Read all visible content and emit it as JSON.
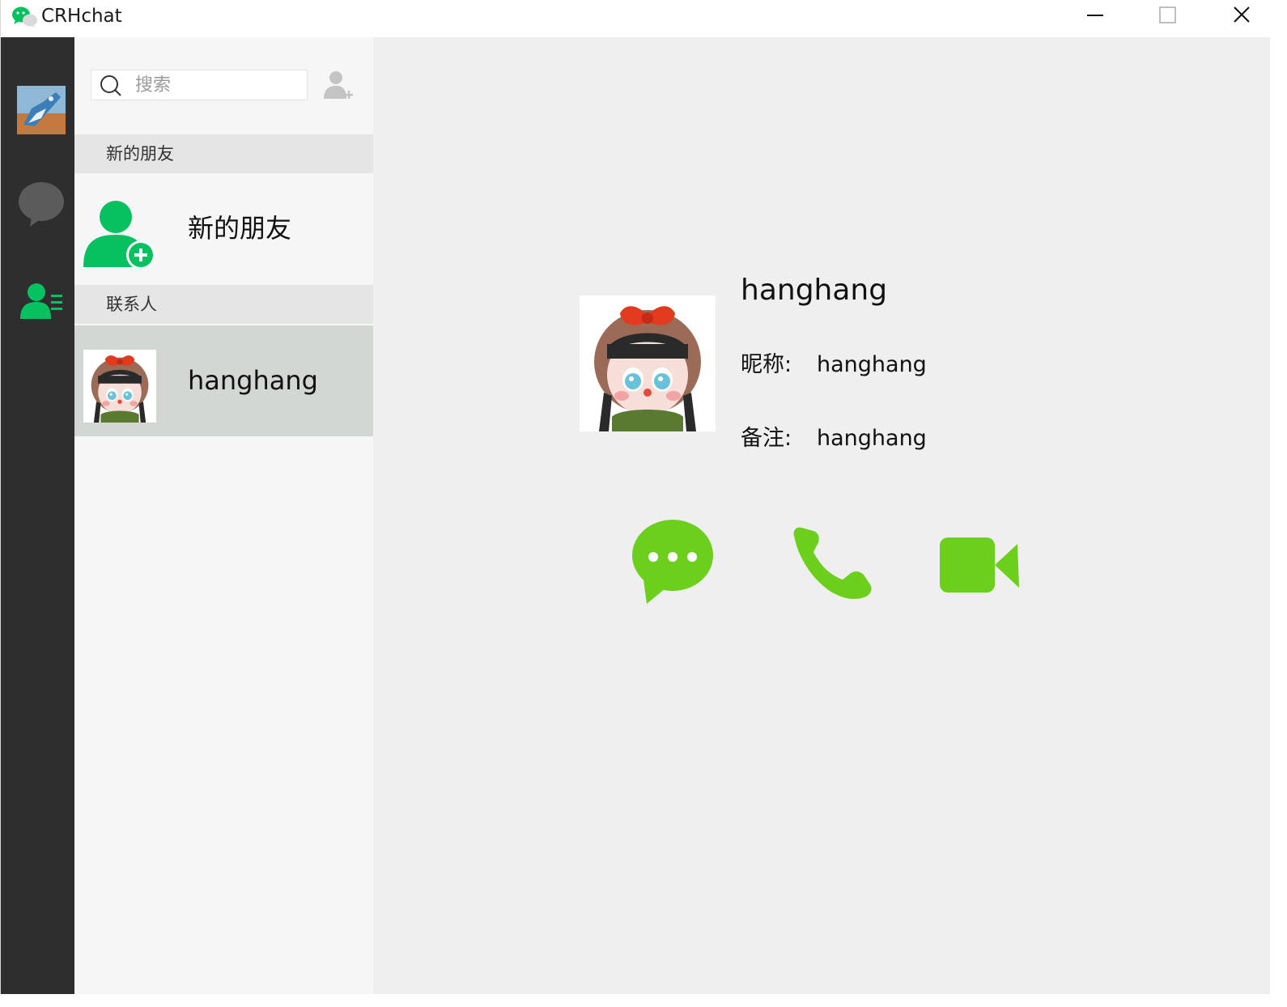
{
  "app": {
    "title": "CRHchat",
    "accent": "#07c160",
    "action_color": "#6ccf1b"
  },
  "titlebar": {
    "minimize": "minimize-icon",
    "maximize": "maximize-icon",
    "close": "close-icon"
  },
  "nav": {
    "items": [
      "avatar",
      "chat-bubble-icon",
      "contacts-icon"
    ],
    "active": "contacts"
  },
  "search": {
    "placeholder": "搜索",
    "value": ""
  },
  "list": {
    "sections": [
      {
        "header": "新的朋友",
        "items": [
          {
            "label": "新的朋友",
            "icon": "add-user-icon"
          }
        ]
      },
      {
        "header": "联系人",
        "items": [
          {
            "label": "hanghang",
            "selected": true
          }
        ]
      }
    ]
  },
  "detail": {
    "name": "hanghang",
    "nickname_label": "昵称:",
    "nickname": "hanghang",
    "remark_label": "备注:",
    "remark": "hanghang",
    "actions": [
      "message-icon",
      "phone-icon",
      "video-icon"
    ]
  }
}
